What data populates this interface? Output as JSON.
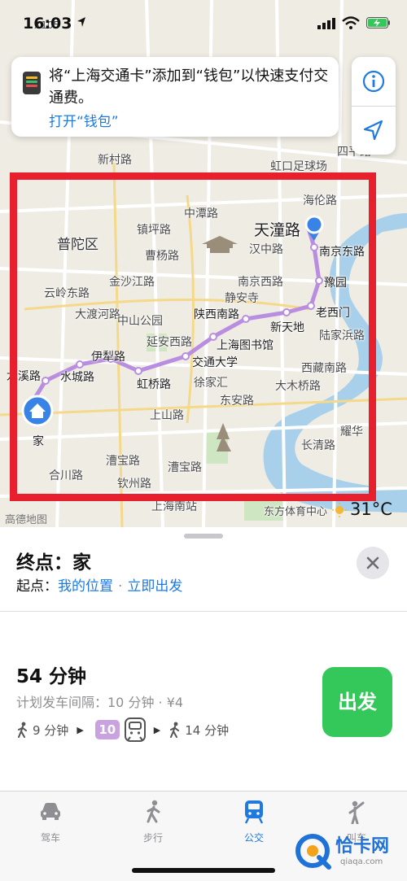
{
  "status_bar": {
    "time": "16:03"
  },
  "wallet_banner": {
    "message": "将“上海交通卡”添加到“钱包”以快速支付交通费。",
    "link": "打开“钱包”"
  },
  "map": {
    "labels": {
      "x105": "X105",
      "wu_cheng_lu": "四平路",
      "xincun_lu": "新村路",
      "hongkou_stadium": "虹口足球场",
      "haolun_lu": "海伦路",
      "sile_lu": "四平路",
      "putuo_qu": "普陀区",
      "zhenping_lu": "镇坪路",
      "zhongtan_lu": "中潭路",
      "tiantong_lu": "天潼路",
      "hanzhong_lu": "汉中路",
      "nanjing_dong_lu": "南京东路",
      "caoyang_lu": "曹杨路",
      "jinshajiang_lu": "金沙江路",
      "nanjing_xi_lu": "南京西路",
      "yuyuan": "豫园",
      "yunling_dong_lu": "云岭东路",
      "jingan_si": "静安寺",
      "laoximen": "老西门",
      "daheshan_lu": "大渡河路",
      "zhongshan_park": "中山公园",
      "shaanxi_nan_lu": "陕西南路",
      "xintiandi": "新天地",
      "yanan_xi_lu": "延安西路",
      "lujiabang_lu": "陆家浜路",
      "shanghai_library": "上海图书馆",
      "yili_lu": "伊犁路",
      "jiaotong_univ": "交通大学",
      "xizang_nan_lu": "西藏南路",
      "longxi_lu": "龙溪路",
      "shuicheng_lu": "水城路",
      "hongqiao_lu": "虹桥路",
      "xujiahui": "徐家汇",
      "damuqiao_lu": "大木桥路",
      "dongan_lu": "东安路",
      "shangshan_lu": "上山路",
      "yaohua": "耀华",
      "changqing_lu": "长清路",
      "home": "家",
      "caobao_lu_1": "漕宝路",
      "caobao_lu_2": "漕宝路",
      "hechuan_lu": "合川路",
      "shanghai_south": "上海南站",
      "oriental_sports": "东方体育中心",
      "jinzhong_lu": "钦州路"
    },
    "attribution": "高德地图",
    "temperature": "31°C",
    "route_color": "#b98ee0",
    "annotation_color": "#e8202e"
  },
  "sheet": {
    "destination": "终点：家",
    "origin_label": "起点：",
    "origin_value": "我的位置",
    "depart_value": "立即出发",
    "route": {
      "duration": "54 分钟",
      "frequency": "计划发车间隔：10 分钟 · ¥4",
      "walk_start": "9 分钟",
      "line": "10",
      "walk_end": "14 分钟",
      "go_button": "出发"
    }
  },
  "tabs": [
    {
      "label": "驾车",
      "icon": "car-icon"
    },
    {
      "label": "步行",
      "icon": "walk-icon"
    },
    {
      "label": "公交",
      "icon": "transit-icon",
      "active": true
    },
    {
      "label": "叫车",
      "icon": "rideshare-icon"
    }
  ],
  "watermark": {
    "text": "恰卡网",
    "sub": "qiaqa.com"
  }
}
